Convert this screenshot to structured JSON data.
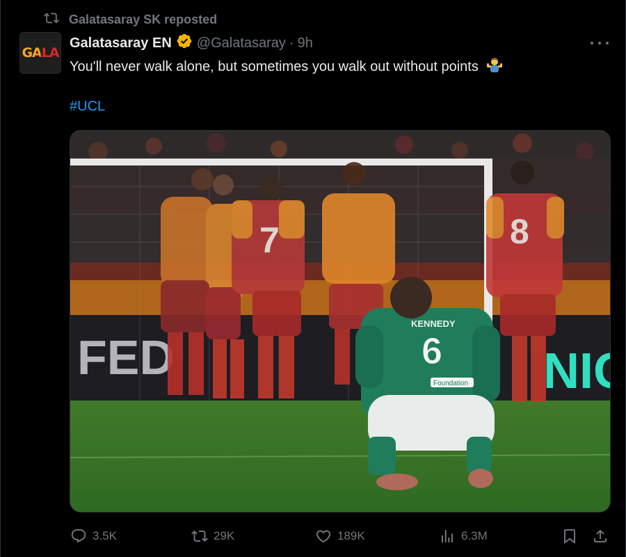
{
  "repost": {
    "label": "Galatasaray SK reposted"
  },
  "author": {
    "avatar_text": "GALA",
    "display_name": "Galatasaray EN",
    "handle": "@Galatasaray",
    "separator": "·",
    "time": "9h"
  },
  "tweet": {
    "text": "You'll never walk alone, but sometimes you walk out without points",
    "emoji": "🤷‍♂️",
    "hashtag": "#UCL"
  },
  "media": {
    "description_icon": "photo",
    "player_number_front": "6",
    "player_name_front": "KENNEDY",
    "sponsor_front": "Foundation",
    "banner_text": "FED",
    "banner_text_right": "NIG"
  },
  "actions": {
    "replies": "3.5K",
    "reposts": "29K",
    "likes": "189K",
    "views": "6.3M"
  },
  "colors": {
    "background": "#000000",
    "text": "#e7e9ea",
    "muted": "#71767b",
    "link": "#1d9bf0",
    "verified": "#f4b400"
  }
}
